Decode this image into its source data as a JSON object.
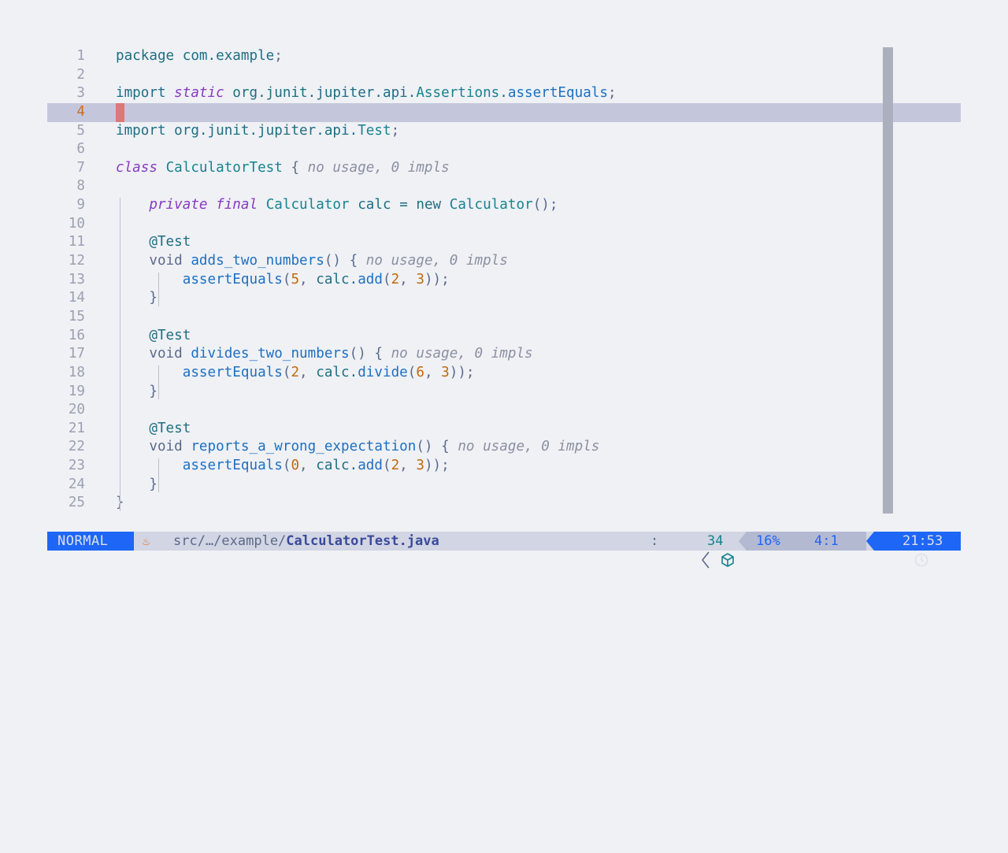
{
  "editor": {
    "current_line": 4,
    "lines": [
      {
        "n": "1",
        "tokens": [
          [
            "kw",
            "package"
          ],
          [
            "plain",
            " com.example"
          ],
          [
            "pun",
            ";"
          ]
        ]
      },
      {
        "n": "2",
        "tokens": []
      },
      {
        "n": "3",
        "tokens": [
          [
            "kw",
            "import"
          ],
          [
            "plain",
            " "
          ],
          [
            "ikw",
            "static"
          ],
          [
            "plain",
            " org.junit.jupiter.api."
          ],
          [
            "cls",
            "Assertions"
          ],
          [
            "plain",
            "."
          ],
          [
            "fnd",
            "assertEquals"
          ],
          [
            "pun",
            ";"
          ]
        ]
      },
      {
        "n": "4",
        "tokens": []
      },
      {
        "n": "5",
        "tokens": [
          [
            "kw",
            "import"
          ],
          [
            "plain",
            " org.junit.jupiter.api."
          ],
          [
            "cls",
            "Test"
          ],
          [
            "pun",
            ";"
          ]
        ]
      },
      {
        "n": "6",
        "tokens": []
      },
      {
        "n": "7",
        "tokens": [
          [
            "ikw",
            "class"
          ],
          [
            "plain",
            " "
          ],
          [
            "cls",
            "CalculatorTest"
          ],
          [
            "plain",
            " "
          ],
          [
            "pun",
            "{"
          ],
          [
            "plain",
            " "
          ],
          [
            "hint",
            "no usage, 0 impls"
          ]
        ]
      },
      {
        "n": "8",
        "tokens": []
      },
      {
        "n": "9",
        "tokens": [
          [
            "plain",
            "    "
          ],
          [
            "ikw",
            "private"
          ],
          [
            "plain",
            " "
          ],
          [
            "ikw",
            "final"
          ],
          [
            "plain",
            " "
          ],
          [
            "cls",
            "Calculator"
          ],
          [
            "plain",
            " calc "
          ],
          [
            "op",
            "="
          ],
          [
            "plain",
            " new "
          ],
          [
            "cls",
            "Calculator"
          ],
          [
            "pun",
            "();"
          ]
        ]
      },
      {
        "n": "10",
        "tokens": []
      },
      {
        "n": "11",
        "tokens": [
          [
            "plain",
            "    "
          ],
          [
            "ann",
            "@Test"
          ]
        ]
      },
      {
        "n": "12",
        "tokens": [
          [
            "plain",
            "    "
          ],
          [
            "pun",
            "void"
          ],
          [
            "plain",
            " "
          ],
          [
            "fnd",
            "adds_two_numbers"
          ],
          [
            "pun",
            "() {"
          ],
          [
            "plain",
            " "
          ],
          [
            "hint",
            "no usage, 0 impls"
          ]
        ]
      },
      {
        "n": "13",
        "tokens": [
          [
            "plain",
            "        "
          ],
          [
            "fnd",
            "assertEquals"
          ],
          [
            "pun",
            "("
          ],
          [
            "num",
            "5"
          ],
          [
            "pun",
            ", "
          ],
          [
            "plain",
            "calc."
          ],
          [
            "fnd",
            "add"
          ],
          [
            "pun",
            "("
          ],
          [
            "num",
            "2"
          ],
          [
            "pun",
            ", "
          ],
          [
            "num",
            "3"
          ],
          [
            "pun",
            "));"
          ]
        ]
      },
      {
        "n": "14",
        "tokens": [
          [
            "plain",
            "    "
          ],
          [
            "pun",
            "}"
          ]
        ]
      },
      {
        "n": "15",
        "tokens": []
      },
      {
        "n": "16",
        "tokens": [
          [
            "plain",
            "    "
          ],
          [
            "ann",
            "@Test"
          ]
        ]
      },
      {
        "n": "17",
        "tokens": [
          [
            "plain",
            "    "
          ],
          [
            "pun",
            "void"
          ],
          [
            "plain",
            " "
          ],
          [
            "fnd",
            "divides_two_numbers"
          ],
          [
            "pun",
            "() {"
          ],
          [
            "plain",
            " "
          ],
          [
            "hint",
            "no usage, 0 impls"
          ]
        ]
      },
      {
        "n": "18",
        "tokens": [
          [
            "plain",
            "        "
          ],
          [
            "fnd",
            "assertEquals"
          ],
          [
            "pun",
            "("
          ],
          [
            "num",
            "2"
          ],
          [
            "pun",
            ", "
          ],
          [
            "plain",
            "calc."
          ],
          [
            "fnd",
            "divide"
          ],
          [
            "pun",
            "("
          ],
          [
            "num",
            "6"
          ],
          [
            "pun",
            ", "
          ],
          [
            "num",
            "3"
          ],
          [
            "pun",
            "));"
          ]
        ]
      },
      {
        "n": "19",
        "tokens": [
          [
            "plain",
            "    "
          ],
          [
            "pun",
            "}"
          ]
        ]
      },
      {
        "n": "20",
        "tokens": []
      },
      {
        "n": "21",
        "tokens": [
          [
            "plain",
            "    "
          ],
          [
            "ann",
            "@Test"
          ]
        ]
      },
      {
        "n": "22",
        "tokens": [
          [
            "plain",
            "    "
          ],
          [
            "pun",
            "void"
          ],
          [
            "plain",
            " "
          ],
          [
            "fnd",
            "reports_a_wrong_expectation"
          ],
          [
            "pun",
            "() {"
          ],
          [
            "plain",
            " "
          ],
          [
            "hint",
            "no usage, 0 impls"
          ]
        ]
      },
      {
        "n": "23",
        "tokens": [
          [
            "plain",
            "        "
          ],
          [
            "fnd",
            "assertEquals"
          ],
          [
            "pun",
            "("
          ],
          [
            "num",
            "0"
          ],
          [
            "pun",
            ", "
          ],
          [
            "plain",
            "calc."
          ],
          [
            "fnd",
            "add"
          ],
          [
            "pun",
            "("
          ],
          [
            "num",
            "2"
          ],
          [
            "pun",
            ", "
          ],
          [
            "num",
            "3"
          ],
          [
            "pun",
            "));"
          ]
        ]
      },
      {
        "n": "24",
        "tokens": [
          [
            "plain",
            "    "
          ],
          [
            "pun",
            "}"
          ]
        ]
      },
      {
        "n": "25",
        "tokens": [
          [
            "pun",
            "}"
          ]
        ]
      }
    ]
  },
  "statusbar": {
    "mode": "NORMAL",
    "file_icon": "java-icon",
    "path_prefix": "src/…/example/",
    "filename": "CalculatorTest.java",
    "colon": ":",
    "chevron": "〈",
    "box_icon": "package-icon",
    "count": "34",
    "percent": "16%",
    "position": "4:1",
    "clock_icon": "clock-icon",
    "time": "21:53"
  }
}
